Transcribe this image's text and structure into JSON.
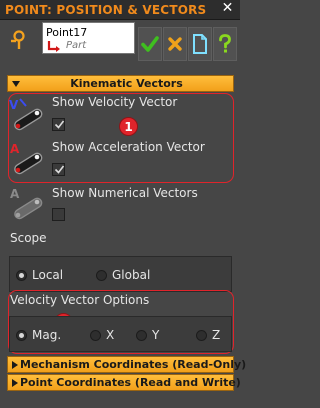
{
  "window": {
    "title": "POINT: POSITION & VECTORS",
    "close_glyph": "✕"
  },
  "point": {
    "name": "Point17",
    "part_label": "Part"
  },
  "toolbar": {
    "buttons": [
      {
        "name": "ok-button",
        "icon": "check-icon",
        "color": "#3fbf1f"
      },
      {
        "name": "cancel-button",
        "icon": "x-icon",
        "color": "#f0a21a"
      },
      {
        "name": "document-button",
        "icon": "document-icon",
        "color": "#7fe0ff"
      },
      {
        "name": "help-button",
        "icon": "question-icon",
        "color": "#8ad81e"
      }
    ]
  },
  "kinematic": {
    "header": "Kinematic Vectors",
    "group_badge": "1",
    "options": [
      {
        "label": "Show Velocity Vector",
        "checked": true,
        "icon": "velocity-vector-icon"
      },
      {
        "label": "Show Acceleration Vector",
        "checked": true,
        "icon": "acceleration-vector-icon"
      },
      {
        "label": "Show Numerical Vectors",
        "checked": false,
        "icon": "numerical-vector-icon"
      }
    ],
    "scope_label": "Scope",
    "scope_options": [
      {
        "label": "Local",
        "selected": true
      },
      {
        "label": "Global",
        "selected": false
      }
    ]
  },
  "velocity_options": {
    "label": "Velocity Vector Options",
    "group_badge": "2",
    "options": [
      {
        "label": "Mag.",
        "selected": true
      },
      {
        "label": "X",
        "selected": false
      },
      {
        "label": "Y",
        "selected": false
      },
      {
        "label": "Z",
        "selected": false
      }
    ]
  },
  "sections": {
    "mechanism": "Mechanism Coordinates (Read-Only)",
    "point_coords": "Point Coordinates (Read and Write)"
  },
  "colors": {
    "accent": "#f08a1c",
    "header_bg": "#f8ae2a",
    "highlight_red": "#e0242b"
  }
}
